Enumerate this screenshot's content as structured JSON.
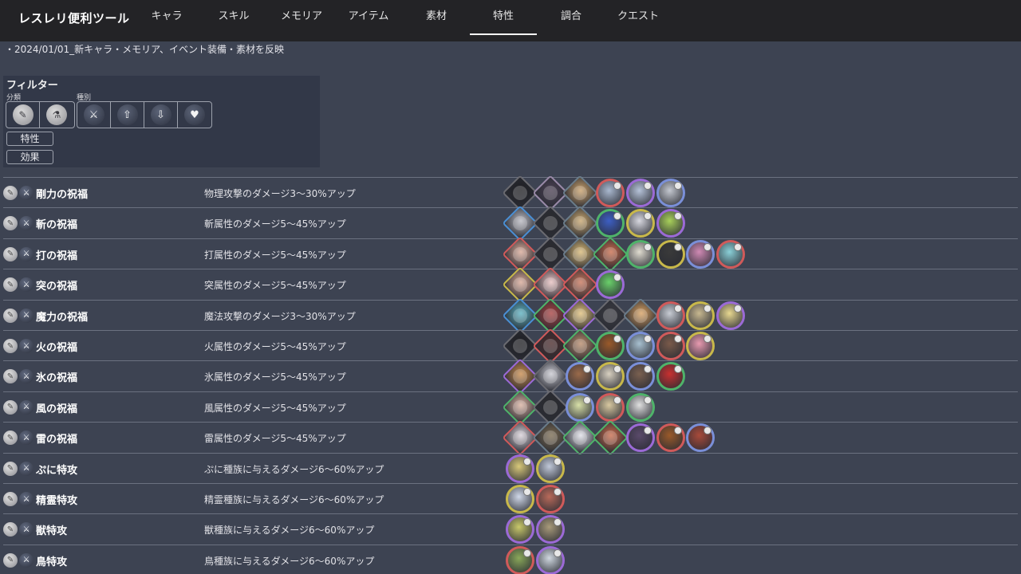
{
  "header": {
    "title": "レスレリ便利ツール",
    "tabs": [
      "キャラ",
      "スキル",
      "メモリア",
      "アイテム",
      "素材",
      "特性",
      "調合",
      "クエスト"
    ],
    "active_tab": "特性"
  },
  "notice": "・2024/01/01_新キャラ・メモリア、イベント装備・素材を反映",
  "filter": {
    "title": "フィルター",
    "category_label": "分類",
    "kind_label": "種別",
    "category_icons": [
      "character-icon",
      "item-icon"
    ],
    "kind_icons": [
      "attack-icon",
      "buff-icon",
      "debuff-icon",
      "heal-icon"
    ],
    "trait_button": "特性",
    "effect_button": "効果"
  },
  "traits": [
    {
      "name": "剛力の祝福",
      "desc": "物理攻撃のダメージ3〜30%アップ",
      "thumbs": [
        {
          "k": "d",
          "c": "#6a6a70",
          "b": "#1e1e22"
        },
        {
          "k": "d",
          "c": "#9a8aa8",
          "b": "#4a3f52"
        },
        {
          "k": "d",
          "c": "#6a7c8a",
          "b": "#c9a06a"
        },
        {
          "k": "c",
          "c": "#d05a5a",
          "b": "#a9b8cf"
        },
        {
          "k": "c",
          "c": "#9b6ad6",
          "b": "#b6c3d9"
        },
        {
          "k": "c",
          "c": "#7a8fd8",
          "b": "#c4c8d0"
        }
      ]
    },
    {
      "name": "斬の祝福",
      "desc": "斬属性のダメージ5〜45%アップ",
      "thumbs": [
        {
          "k": "d",
          "c": "#4a8fd4",
          "b": "#b8b8c0"
        },
        {
          "k": "d",
          "c": "#6a6a70",
          "b": "#2a2a2e"
        },
        {
          "k": "d",
          "c": "#6a7c8a",
          "b": "#c8a66e"
        },
        {
          "k": "c",
          "c": "#4fb36a",
          "b": "#3d5fc4"
        },
        {
          "k": "c",
          "c": "#c8b84a",
          "b": "#d8d8e0"
        },
        {
          "k": "c",
          "c": "#9b6ad6",
          "b": "#a8d05a"
        }
      ]
    },
    {
      "name": "打の祝福",
      "desc": "打属性のダメージ5〜45%アップ",
      "thumbs": [
        {
          "k": "d",
          "c": "#d05a5a",
          "b": "#d8a896"
        },
        {
          "k": "d",
          "c": "#6a6a70",
          "b": "#2a2a2e"
        },
        {
          "k": "d",
          "c": "#6a7c8a",
          "b": "#d8b874"
        },
        {
          "k": "d",
          "c": "#4fb36a",
          "b": "#c86a4a"
        },
        {
          "k": "c",
          "c": "#4fb36a",
          "b": "#e0dcd0"
        },
        {
          "k": "c",
          "c": "#c8b84a",
          "b": "#3a3a3a"
        },
        {
          "k": "c",
          "c": "#7a8fd8",
          "b": "#d08ab4"
        },
        {
          "k": "c",
          "c": "#d05a5a",
          "b": "#8ad0d8"
        }
      ]
    },
    {
      "name": "突の祝福",
      "desc": "突属性のダメージ5〜45%アップ",
      "thumbs": [
        {
          "k": "d",
          "c": "#c8b84a",
          "b": "#d8a896"
        },
        {
          "k": "d",
          "c": "#d05a5a",
          "b": "#e8c0c0"
        },
        {
          "k": "d",
          "c": "#d05a5a",
          "b": "#c8745a"
        },
        {
          "k": "c",
          "c": "#9b6ad6",
          "b": "#6ad06a"
        }
      ]
    },
    {
      "name": "魔力の祝福",
      "desc": "魔法攻撃のダメージ3〜30%アップ",
      "thumbs": [
        {
          "k": "d",
          "c": "#4a8fd4",
          "b": "#5ab0c0"
        },
        {
          "k": "d",
          "c": "#4fb36a",
          "b": "#a84040"
        },
        {
          "k": "d",
          "c": "#9b6ad6",
          "b": "#e0c07a"
        },
        {
          "k": "d",
          "c": "#6a6a70",
          "b": "#3a3a40"
        },
        {
          "k": "d",
          "c": "#6a7c8a",
          "b": "#d8a060"
        },
        {
          "k": "c",
          "c": "#d05a5a",
          "b": "#c8ccd4"
        },
        {
          "k": "c",
          "c": "#c8b84a",
          "b": "#c8b890"
        },
        {
          "k": "c",
          "c": "#9b6ad6",
          "b": "#e8d890"
        }
      ]
    },
    {
      "name": "火の祝福",
      "desc": "火属性のダメージ5〜45%アップ",
      "thumbs": [
        {
          "k": "d",
          "c": "#6a6a70",
          "b": "#1e1e22"
        },
        {
          "k": "d",
          "c": "#d05a5a",
          "b": "#4a2a2a"
        },
        {
          "k": "d",
          "c": "#4fb36a",
          "b": "#b88a6a"
        },
        {
          "k": "c",
          "c": "#4fb36a",
          "b": "#9a5a2a"
        },
        {
          "k": "c",
          "c": "#7a8fd8",
          "b": "#a8c0d0"
        },
        {
          "k": "c",
          "c": "#d05a5a",
          "b": "#7a5a4a"
        },
        {
          "k": "c",
          "c": "#c8b84a",
          "b": "#e89ab0"
        }
      ]
    },
    {
      "name": "氷の祝福",
      "desc": "氷属性のダメージ5〜45%アップ",
      "thumbs": [
        {
          "k": "d",
          "c": "#9b6ad6",
          "b": "#c88a4a"
        },
        {
          "k": "d",
          "c": "#6a6a70",
          "b": "#c8c8d0"
        },
        {
          "k": "c",
          "c": "#7a8fd8",
          "b": "#9a6a4a"
        },
        {
          "k": "c",
          "c": "#c8b84a",
          "b": "#d8d0c0"
        },
        {
          "k": "c",
          "c": "#7a8fd8",
          "b": "#7a6050"
        },
        {
          "k": "c",
          "c": "#4fb36a",
          "b": "#c83030"
        }
      ]
    },
    {
      "name": "風の祝福",
      "desc": "風属性のダメージ5〜45%アップ",
      "thumbs": [
        {
          "k": "d",
          "c": "#4fb36a",
          "b": "#d8b0a0"
        },
        {
          "k": "d",
          "c": "#6a6a70",
          "b": "#2a2a2e"
        },
        {
          "k": "c",
          "c": "#7a8fd8",
          "b": "#d8e0a8"
        },
        {
          "k": "c",
          "c": "#d05a5a",
          "b": "#d8c8a0"
        },
        {
          "k": "c",
          "c": "#4fb36a",
          "b": "#e0e0e0"
        }
      ]
    },
    {
      "name": "雷の祝福",
      "desc": "雷属性のダメージ5〜45%アップ",
      "thumbs": [
        {
          "k": "d",
          "c": "#d05a5a",
          "b": "#d8d0d8"
        },
        {
          "k": "d",
          "c": "#6a7c8a",
          "b": "#7a6a50"
        },
        {
          "k": "d",
          "c": "#4fb36a",
          "b": "#e0e0e8"
        },
        {
          "k": "d",
          "c": "#4fb36a",
          "b": "#c86a4a"
        },
        {
          "k": "c",
          "c": "#9b6ad6",
          "b": "#5a4a6a"
        },
        {
          "k": "c",
          "c": "#d05a5a",
          "b": "#9a5a2a"
        },
        {
          "k": "c",
          "c": "#7a8fd8",
          "b": "#a84a3a"
        }
      ]
    },
    {
      "name": "ぷに特攻",
      "desc": "ぷに種族に与えるダメージ6〜60%アップ",
      "thumbs": [
        {
          "k": "c",
          "c": "#9b6ad6",
          "b": "#d8c87a"
        },
        {
          "k": "c",
          "c": "#c8b84a",
          "b": "#c0c8d8"
        }
      ]
    },
    {
      "name": "精霊特攻",
      "desc": "精霊種族に与えるダメージ6〜60%アップ",
      "thumbs": [
        {
          "k": "c",
          "c": "#c8b84a",
          "b": "#d0d8e8"
        },
        {
          "k": "c",
          "c": "#d05a5a",
          "b": "#b86a5a"
        }
      ]
    },
    {
      "name": "獣特攻",
      "desc": "獣種族に与えるダメージ6〜60%アップ",
      "thumbs": [
        {
          "k": "c",
          "c": "#9b6ad6",
          "b": "#c8c86a"
        },
        {
          "k": "c",
          "c": "#9b6ad6",
          "b": "#a89a7a"
        }
      ]
    },
    {
      "name": "鳥特攻",
      "desc": "鳥種族に与えるダメージ6〜60%アップ",
      "thumbs": [
        {
          "k": "c",
          "c": "#d05a5a",
          "b": "#8aa85a"
        },
        {
          "k": "c",
          "c": "#9b6ad6",
          "b": "#d0d8e0"
        }
      ]
    }
  ]
}
